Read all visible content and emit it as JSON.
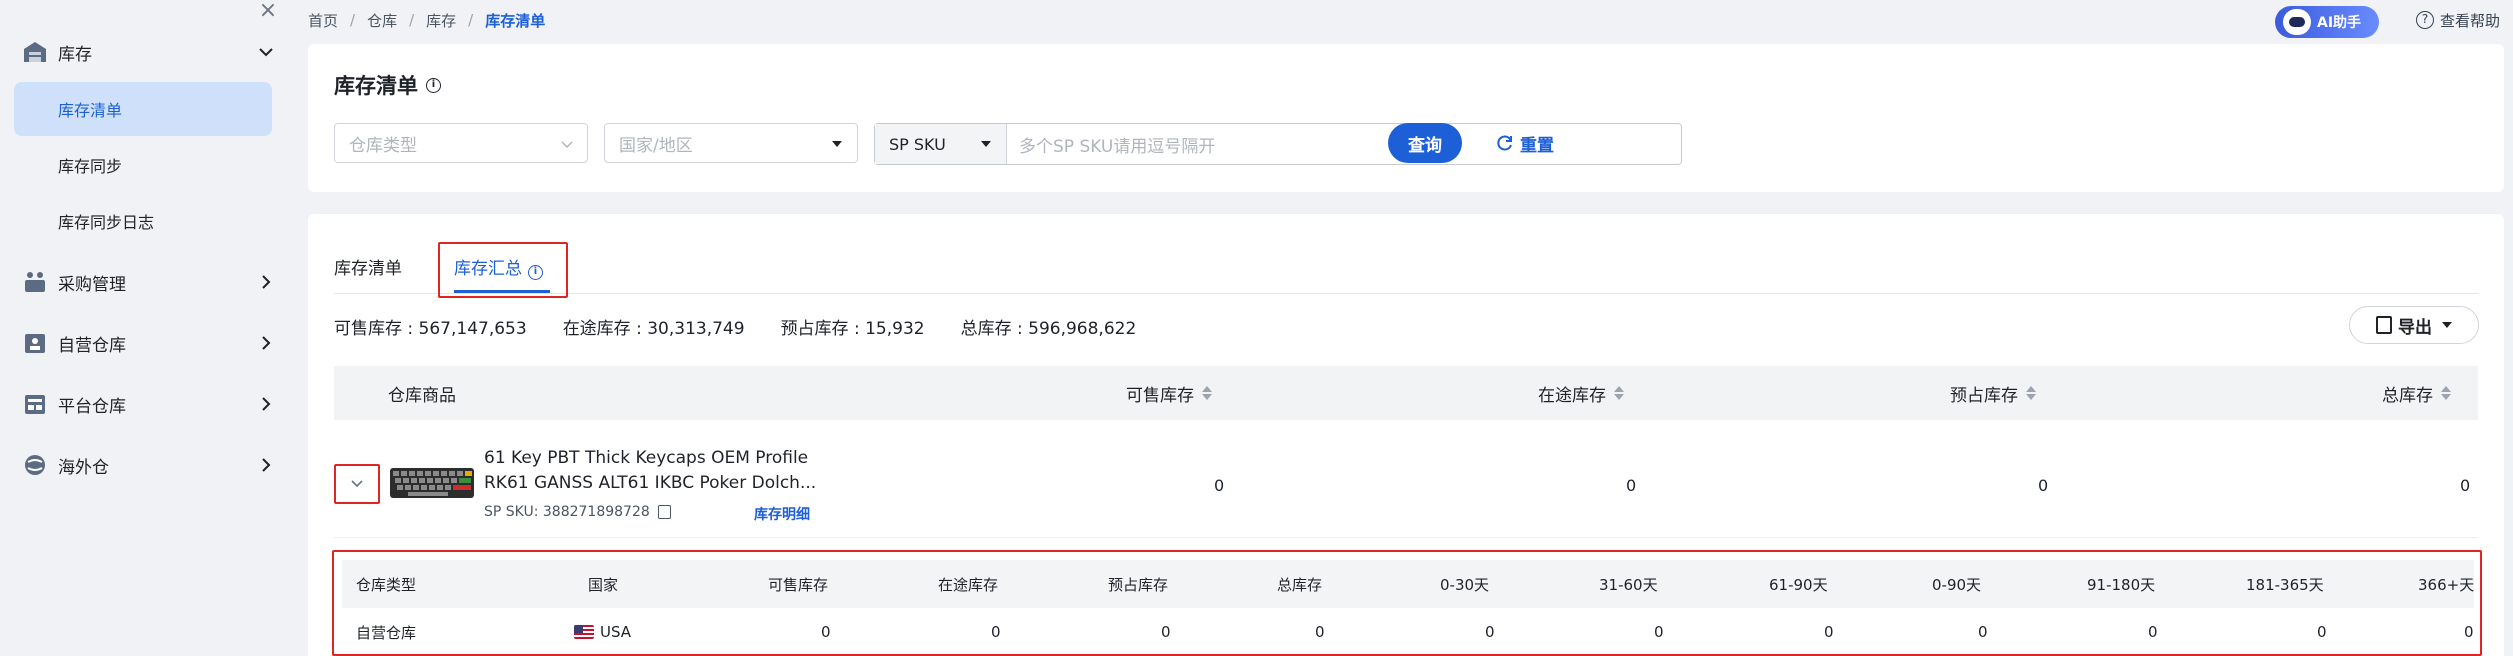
{
  "sidebar": {
    "groups": [
      {
        "label": "库存",
        "icon": "warehouse-icon",
        "expanded": true
      },
      {
        "label": "采购管理",
        "icon": "purchase-icon"
      },
      {
        "label": "自营仓库",
        "icon": "self-warehouse-icon"
      },
      {
        "label": "平台仓库",
        "icon": "platform-warehouse-icon"
      },
      {
        "label": "海外仓",
        "icon": "overseas-warehouse-icon"
      }
    ],
    "items": [
      {
        "label": "库存清单",
        "active": true
      },
      {
        "label": "库存同步"
      },
      {
        "label": "库存同步日志"
      }
    ]
  },
  "breadcrumb": [
    "首页",
    "仓库",
    "库存",
    "库存清单"
  ],
  "header": {
    "ai_label": "AI助手",
    "help_label": "查看帮助"
  },
  "filters": {
    "title": "库存清单",
    "warehouse_type_placeholder": "仓库类型",
    "country_placeholder": "国家/地区",
    "sku_type": "SP SKU",
    "sku_placeholder": "多个SP SKU请用逗号隔开",
    "query_label": "查询",
    "reset_label": "重置"
  },
  "tabs": [
    {
      "label": "库存清单",
      "active": false
    },
    {
      "label": "库存汇总",
      "active": true
    }
  ],
  "stats": {
    "sellable": "可售库存 : 567,147,653",
    "in_transit": "在途库存 : 30,313,749",
    "reserved": "预占库存 : 15,932",
    "total": "总库存 : 596,968,622"
  },
  "export_label": "导出",
  "table": {
    "headers": [
      "仓库商品",
      "可售库存",
      "在途库存",
      "预占库存",
      "总库存"
    ],
    "row": {
      "name": "61 Key PBT Thick Keycaps OEM Profile RK61 GANSS ALT61 IKBC Poker Dolch...",
      "sku": "SP SKU: 388271898728",
      "detail_link": "库存明细",
      "sellable": "0",
      "in_transit": "0",
      "reserved": "0",
      "total": "0"
    }
  },
  "subtable": {
    "headers": [
      "仓库类型",
      "国家",
      "可售库存",
      "在途库存",
      "预占库存",
      "总库存",
      "0-30天",
      "31-60天",
      "61-90天",
      "0-90天",
      "91-180天",
      "181-365天",
      "366+天"
    ],
    "rows": [
      [
        "自营仓库",
        "USA",
        "0",
        "0",
        "0",
        "0",
        "0",
        "0",
        "0",
        "0",
        "0",
        "0",
        "0"
      ]
    ]
  }
}
